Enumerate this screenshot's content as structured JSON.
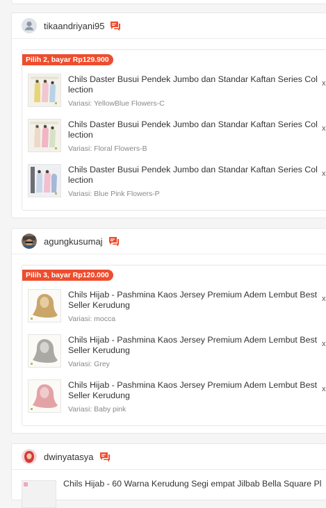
{
  "orders": [
    {
      "username": "tikaandriyani95",
      "promo": "Pilih 2, bayar Rp129.900",
      "items": [
        {
          "name": "Chils Daster Busui Pendek Jumbo dan Standar Kaftan Series Collection",
          "variation": "Variasi: YellowBlue Flowers-C",
          "qty": "x"
        },
        {
          "name": "Chils Daster Busui Pendek Jumbo dan Standar Kaftan Series Collection",
          "variation": "Variasi: Floral Flowers-B",
          "qty": "x"
        },
        {
          "name": "Chils Daster Busui Pendek Jumbo dan Standar Kaftan Series Collection",
          "variation": "Variasi: Blue Pink Flowers-P",
          "qty": "x"
        }
      ]
    },
    {
      "username": "agungkusumaj",
      "promo": "Pilih 3, bayar Rp120.000",
      "items": [
        {
          "name": "Chils Hijab - Pashmina Kaos Jersey Premium Adem Lembut Best Seller Kerudung",
          "variation": "Variasi: mocca",
          "qty": "x"
        },
        {
          "name": "Chils Hijab - Pashmina Kaos Jersey Premium Adem Lembut Best Seller Kerudung",
          "variation": "Variasi: Grey",
          "qty": "x"
        },
        {
          "name": "Chils Hijab - Pashmina Kaos Jersey Premium Adem Lembut Best Seller Kerudung",
          "variation": "Variasi: Baby pink",
          "qty": "x"
        }
      ]
    },
    {
      "username": "dwinyatasya",
      "items": [
        {
          "name": "Chils Hijab - 60 Warna Kerudung Segi empat Jilbab Bella Square Pl"
        }
      ]
    }
  ],
  "colors": {
    "accent": "#ee4d2d",
    "background": "#f5f5f5",
    "muted_text": "#888888"
  },
  "icons": {
    "chat": "chat-bubble-icon",
    "avatar_default": "user-avatar-icon",
    "remove": "close-x"
  }
}
